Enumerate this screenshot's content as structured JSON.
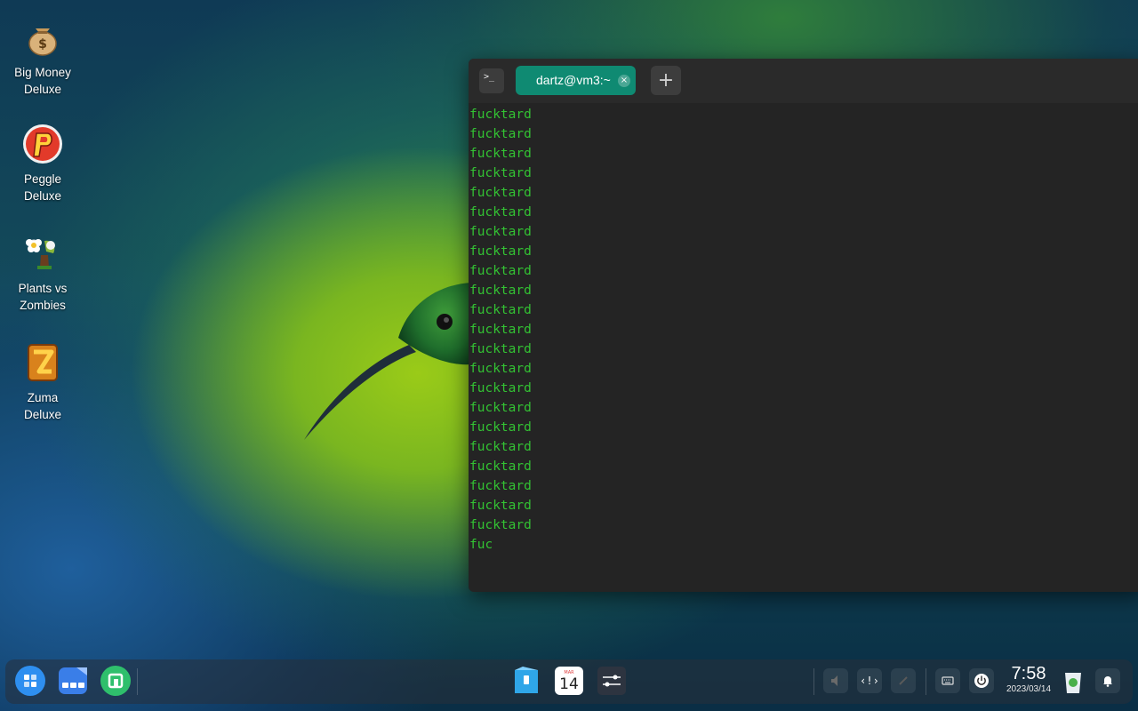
{
  "desktop": {
    "icons": [
      {
        "label": "Big Money\nDeluxe",
        "line1": "Big Money",
        "line2": "Deluxe"
      },
      {
        "label": "Peggle Deluxe",
        "line1": "Peggle",
        "line2": "Deluxe"
      },
      {
        "label": "Plants vs Zombies",
        "line1": "Plants vs",
        "line2": "Zombies"
      },
      {
        "label": "Zuma Deluxe",
        "line1": "Zuma",
        "line2": "Deluxe"
      }
    ],
    "money_symbol": "$"
  },
  "terminal": {
    "app_icon_glyph": ">_",
    "tab_title": "dartz@vm3:~",
    "tab_close_glyph": "×",
    "new_tab_glyph": "+",
    "lines": [
      "fucktard",
      "fucktard",
      "fucktard",
      "fucktard",
      "fucktard",
      "fucktard",
      "fucktard",
      "fucktard",
      "fucktard",
      "fucktard",
      "fucktard",
      "fucktard",
      "fucktard",
      "fucktard",
      "fucktard",
      "fucktard",
      "fucktard",
      "fucktard",
      "fucktard",
      "fucktard",
      "fucktard",
      "fucktard",
      "fuc"
    ],
    "text_color": "#33c233",
    "tab_color": "#0f8a72"
  },
  "dock": {
    "calendar_day": "14",
    "calendar_month": "MAR",
    "tray_code_glyph": "‹!›",
    "clock": {
      "time": "7:58",
      "date": "2023/03/14"
    }
  }
}
